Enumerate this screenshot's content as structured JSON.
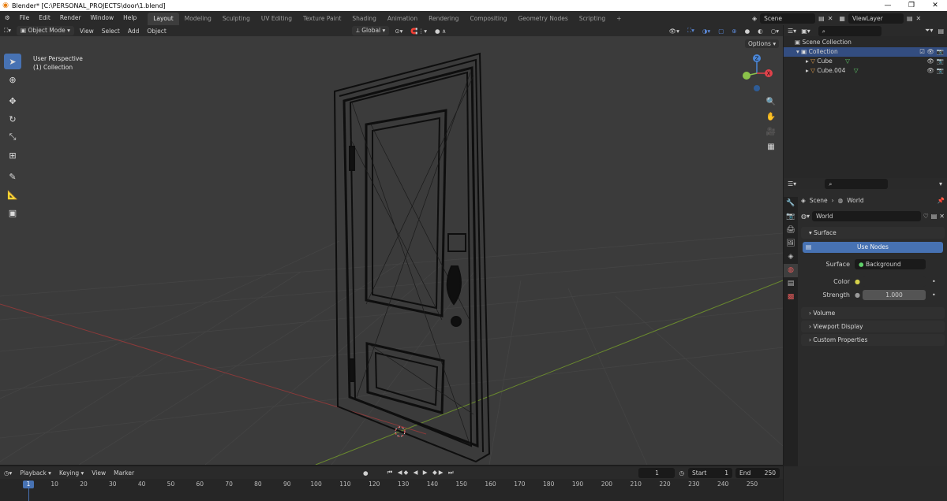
{
  "window": {
    "title": "Blender* [C:\\PERSONAL_PROJECTS\\door\\1.blend]",
    "controls": [
      "—",
      "❐",
      "✕"
    ]
  },
  "menu": [
    "File",
    "Edit",
    "Render",
    "Window",
    "Help"
  ],
  "workspaces": [
    "Layout",
    "Modeling",
    "Sculpting",
    "UV Editing",
    "Texture Paint",
    "Shading",
    "Animation",
    "Rendering",
    "Compositing",
    "Geometry Nodes",
    "Scripting",
    "+"
  ],
  "active_workspace": "Layout",
  "scene": {
    "name": "Scene",
    "view_layer": "ViewLayer"
  },
  "viewport_header": {
    "mode": "Object Mode",
    "menus": [
      "View",
      "Select",
      "Add",
      "Object"
    ],
    "orientation": "Global"
  },
  "viewport": {
    "info_line1": "User Perspective",
    "info_line2": "(1) Collection",
    "options": "Options"
  },
  "gizmo": {
    "z": "Z",
    "x": "X",
    "y": "Y"
  },
  "outliner": {
    "root": "Scene Collection",
    "collection": "Collection",
    "objects": [
      "Cube",
      "Cube.004"
    ]
  },
  "properties": {
    "breadcrumb_scene": "Scene",
    "breadcrumb_world": "World",
    "world_name": "World",
    "surface_panel": "Surface",
    "use_nodes": "Use Nodes",
    "surface_label": "Surface",
    "surface_value": "Background",
    "color_label": "Color",
    "strength_label": "Strength",
    "strength_value": "1.000",
    "panels": [
      "Volume",
      "Viewport Display",
      "Custom Properties"
    ]
  },
  "timeline": {
    "menus": [
      "Playback",
      "Keying",
      "View",
      "Marker"
    ],
    "current_frame": "1",
    "start_label": "Start",
    "start": "1",
    "end_label": "End",
    "end": "250",
    "ticks": [
      "1",
      "10",
      "20",
      "30",
      "40",
      "50",
      "60",
      "70",
      "80",
      "90",
      "100",
      "110",
      "120",
      "130",
      "140",
      "150",
      "160",
      "170",
      "180",
      "190",
      "200",
      "210",
      "220",
      "230",
      "240",
      "250"
    ]
  },
  "colors": {
    "accent": "#4772b3",
    "selection": "#334d80",
    "x_axis": "#e2424b",
    "y_axis": "#8bc34a",
    "z_axis": "#4a86d7"
  }
}
